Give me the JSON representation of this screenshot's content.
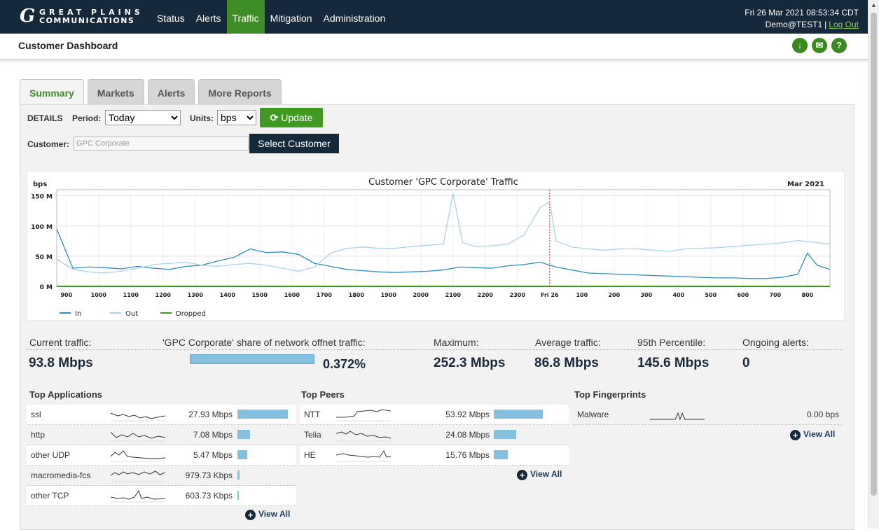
{
  "brand": {
    "line1": "GREAT PLAINS",
    "line2": "COMMUNICATIONS",
    "mark": "G"
  },
  "nav": [
    "Status",
    "Alerts",
    "Traffic",
    "Mitigation",
    "Administration"
  ],
  "header": {
    "datetime": "Fri 26 Mar 2021 08:53:34 CDT",
    "user": "Demo@TEST1",
    "separator": "|",
    "logout": "Log Out"
  },
  "page": {
    "title": "Customer Dashboard"
  },
  "header_icons": [
    "download-icon",
    "mail-icon",
    "help-icon"
  ],
  "tabs": [
    "Summary",
    "Markets",
    "Alerts",
    "More Reports"
  ],
  "controls": {
    "details": "DETAILS",
    "period_label": "Period:",
    "period_value": "Today",
    "units_label": "Units:",
    "units_value": "bps",
    "update": "Update",
    "customer_label": "Customer:",
    "customer_value": "GPC Corporate",
    "select_customer": "Select Customer"
  },
  "chart_data": {
    "type": "line",
    "title": "Customer 'GPC Corporate' Traffic",
    "ylabel": "bps",
    "date_label": "Mar 2021",
    "ylim": [
      0,
      160
    ],
    "yticks": [
      "0 M",
      "50 M",
      "100 M",
      "150 M"
    ],
    "ytick_values": [
      0,
      50,
      100,
      150
    ],
    "xticks": [
      "900",
      "1000",
      "1100",
      "1200",
      "1300",
      "1400",
      "1500",
      "1600",
      "1700",
      "1800",
      "1900",
      "2000",
      "2100",
      "2200",
      "2300",
      "Fri 26",
      "100",
      "200",
      "300",
      "400",
      "500",
      "600",
      "700",
      "800"
    ],
    "xtick_hours": [
      9,
      10,
      11,
      12,
      13,
      14,
      15,
      16,
      17,
      18,
      19,
      20,
      21,
      22,
      23,
      24,
      25,
      26,
      27,
      28,
      29,
      30,
      31,
      32
    ],
    "x_range_hours": [
      8.7,
      32.7
    ],
    "now_marker_hour": 24,
    "series": [
      {
        "name": "In",
        "color": "#2f8fb8",
        "points": [
          [
            8.7,
            95
          ],
          [
            9.2,
            30
          ],
          [
            9.7,
            32
          ],
          [
            10.2,
            31
          ],
          [
            10.7,
            29
          ],
          [
            11.2,
            33
          ],
          [
            11.7,
            30
          ],
          [
            12.2,
            28
          ],
          [
            12.7,
            33
          ],
          [
            13.2,
            35
          ],
          [
            13.7,
            42
          ],
          [
            14.2,
            48
          ],
          [
            14.7,
            62
          ],
          [
            15.2,
            56
          ],
          [
            15.7,
            57
          ],
          [
            16.2,
            53
          ],
          [
            16.7,
            38
          ],
          [
            17.2,
            33
          ],
          [
            17.7,
            28
          ],
          [
            18.2,
            26
          ],
          [
            18.7,
            24
          ],
          [
            19.2,
            23
          ],
          [
            19.7,
            24
          ],
          [
            20.2,
            25
          ],
          [
            20.7,
            27
          ],
          [
            21.2,
            32
          ],
          [
            21.7,
            31
          ],
          [
            22.2,
            30
          ],
          [
            22.7,
            34
          ],
          [
            23.2,
            36
          ],
          [
            23.7,
            40
          ],
          [
            24.2,
            32
          ],
          [
            24.7,
            27
          ],
          [
            25.2,
            22
          ],
          [
            25.7,
            21
          ],
          [
            26.2,
            20
          ],
          [
            26.7,
            19
          ],
          [
            27.2,
            18
          ],
          [
            27.7,
            17
          ],
          [
            28.2,
            16
          ],
          [
            28.7,
            15
          ],
          [
            29.2,
            14
          ],
          [
            29.7,
            14
          ],
          [
            30.2,
            13
          ],
          [
            30.7,
            13
          ],
          [
            31.2,
            15
          ],
          [
            31.7,
            20
          ],
          [
            32.0,
            55
          ],
          [
            32.3,
            35
          ],
          [
            32.7,
            28
          ]
        ]
      },
      {
        "name": "Out",
        "color": "#a9d3ea",
        "points": [
          [
            8.7,
            45
          ],
          [
            9.2,
            28
          ],
          [
            9.7,
            24
          ],
          [
            10.2,
            22
          ],
          [
            10.7,
            25
          ],
          [
            11.2,
            30
          ],
          [
            11.7,
            36
          ],
          [
            12.2,
            38
          ],
          [
            12.7,
            40
          ],
          [
            13.2,
            35
          ],
          [
            13.7,
            33
          ],
          [
            14.2,
            36
          ],
          [
            14.7,
            38
          ],
          [
            15.2,
            35
          ],
          [
            15.7,
            30
          ],
          [
            16.2,
            25
          ],
          [
            16.7,
            32
          ],
          [
            17.2,
            55
          ],
          [
            17.7,
            63
          ],
          [
            18.2,
            65
          ],
          [
            18.7,
            63
          ],
          [
            19.2,
            63
          ],
          [
            19.7,
            66
          ],
          [
            20.2,
            68
          ],
          [
            20.7,
            70
          ],
          [
            21.0,
            154
          ],
          [
            21.3,
            72
          ],
          [
            21.7,
            66
          ],
          [
            22.2,
            67
          ],
          [
            22.7,
            70
          ],
          [
            23.2,
            85
          ],
          [
            23.7,
            130
          ],
          [
            24.0,
            140
          ],
          [
            24.2,
            75
          ],
          [
            24.7,
            65
          ],
          [
            25.2,
            62
          ],
          [
            25.7,
            60
          ],
          [
            26.2,
            62
          ],
          [
            26.7,
            62
          ],
          [
            27.2,
            60
          ],
          [
            27.7,
            58
          ],
          [
            28.2,
            62
          ],
          [
            28.7,
            63
          ],
          [
            29.2,
            64
          ],
          [
            29.7,
            66
          ],
          [
            30.2,
            68
          ],
          [
            30.7,
            70
          ],
          [
            31.2,
            72
          ],
          [
            31.7,
            76
          ],
          [
            32.2,
            73
          ],
          [
            32.7,
            70
          ]
        ]
      },
      {
        "name": "Dropped",
        "color": "#3f9a22",
        "points": [
          [
            8.7,
            0
          ],
          [
            32.7,
            0
          ]
        ]
      }
    ]
  },
  "stats": {
    "current_label": "Current traffic:",
    "current_value": "93.8 Mbps",
    "share_label": "'GPC Corporate' share of network offnet traffic:",
    "share_value": "0.372%",
    "max_label": "Maximum:",
    "max_value": "252.3 Mbps",
    "avg_label": "Average traffic:",
    "avg_value": "86.8 Mbps",
    "p95_label": "95th Percentile:",
    "p95_value": "145.6 Mbps",
    "alerts_label": "Ongoing alerts:",
    "alerts_value": "0"
  },
  "top_applications": {
    "title": "Top Applications",
    "rows": [
      {
        "name": "ssl",
        "value": "27.93 Mbps",
        "fraction": 1.0
      },
      {
        "name": "http",
        "value": "7.08 Mbps",
        "fraction": 0.25
      },
      {
        "name": "other UDP",
        "value": "5.47 Mbps",
        "fraction": 0.2
      },
      {
        "name": "macromedia-fcs",
        "value": "979.73 Kbps",
        "fraction": 0.035
      },
      {
        "name": "other TCP",
        "value": "603.73 Kbps",
        "fraction": 0.022
      }
    ],
    "view_all": "View All"
  },
  "top_peers": {
    "title": "Top Peers",
    "rows": [
      {
        "name": "NTT",
        "value": "53.92 Mbps",
        "fraction": 1.0
      },
      {
        "name": "Telia",
        "value": "24.08 Mbps",
        "fraction": 0.45
      },
      {
        "name": "HE",
        "value": "15.76 Mbps",
        "fraction": 0.29
      }
    ],
    "view_all": "View All"
  },
  "top_fingerprints": {
    "title": "Top Fingerprints",
    "rows": [
      {
        "name": "Malware",
        "value": "0.00 bps"
      }
    ],
    "view_all": "View All"
  }
}
